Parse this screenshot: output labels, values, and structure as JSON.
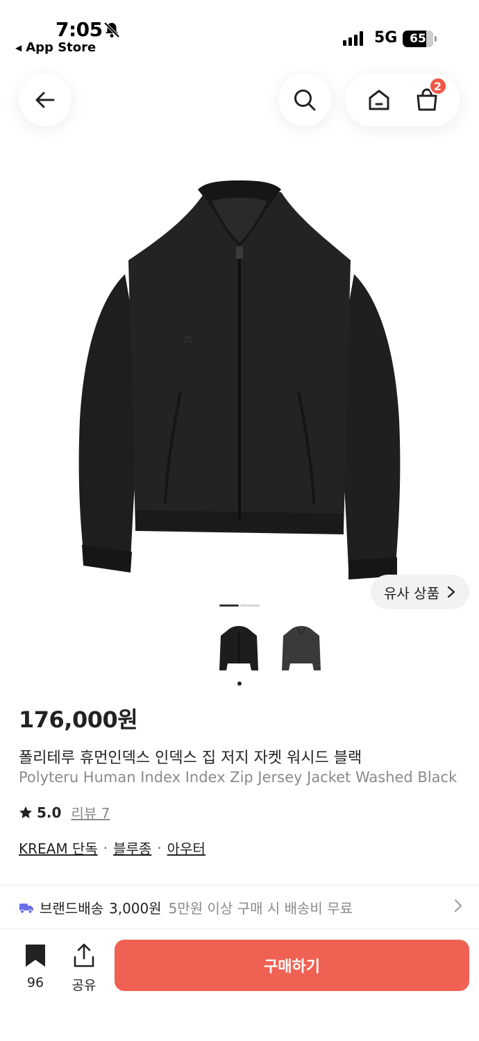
{
  "status_bar": {
    "time": "7:05",
    "back_app": "App Store",
    "network": "5G",
    "battery": "65"
  },
  "nav": {
    "cart_count": "2"
  },
  "gallery": {
    "similar_label": "유사 상품",
    "image_count": 2,
    "current_index": 1
  },
  "product": {
    "price": "176,000원",
    "name_ko": "폴리테루 휴먼인덱스 인덱스 집 저지 자켓 워시드 블랙",
    "name_en": "Polyteru Human Index Index Zip Jersey Jacket Washed Black",
    "rating": "5.0",
    "review_label": "리뷰 7",
    "tags": [
      "KREAM 단독",
      "블루종",
      "아우터"
    ]
  },
  "shipping": {
    "title": "브랜드배송",
    "fee": "3,000원",
    "free_condition": "5만원 이상 구매 시 배송비 무료"
  },
  "bottom_bar": {
    "save_count": "96",
    "share_label": "공유",
    "buy_label": "구매하기"
  },
  "colors": {
    "accent": "#ef6253",
    "badge": "#f15746",
    "shipping_icon": "#6a6fe6"
  },
  "icons": [
    "arrow-left-icon",
    "search-icon",
    "home-icon",
    "shopping-bag-icon",
    "truck-icon",
    "chevron-right-icon",
    "bookmark-icon",
    "share-icon",
    "star-icon",
    "bell-off-icon"
  ]
}
